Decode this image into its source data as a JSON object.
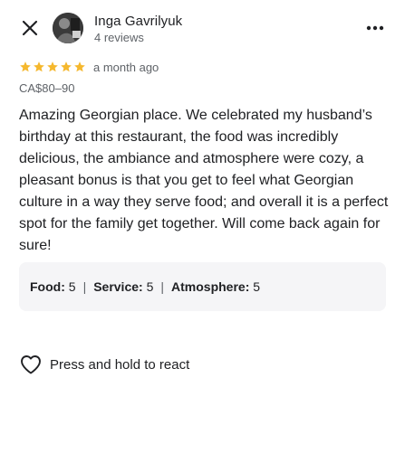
{
  "reviewer": {
    "name": "Inga Gavrilyuk",
    "reviews_count": "4 reviews"
  },
  "review": {
    "stars": 5,
    "time_ago": "a month ago",
    "price": "CA$80–90",
    "text": "Amazing Georgian place. We celebrated my husband’s birthday at this restaurant, the food was incredibly delicious, the ambiance and atmosphere were cozy, a pleasant bonus is that you get to feel what Georgian culture in a way they serve food; and overall it is a perfect spot for the family get together. Will come back again for sure!"
  },
  "sub_ratings": [
    {
      "label": "Food:",
      "value": "5"
    },
    {
      "label": "Service:",
      "value": "5"
    },
    {
      "label": "Atmosphere:",
      "value": "5"
    }
  ],
  "react": {
    "label": "Press and hold to react"
  },
  "icons": {
    "close": "close-icon",
    "more": "more-vert-icon",
    "star": "star-icon",
    "heart": "heart-outline-icon"
  },
  "colors": {
    "star": "#F5B82E",
    "text": "#202124",
    "muted": "#5f6368",
    "box_bg": "#f5f5f7"
  }
}
